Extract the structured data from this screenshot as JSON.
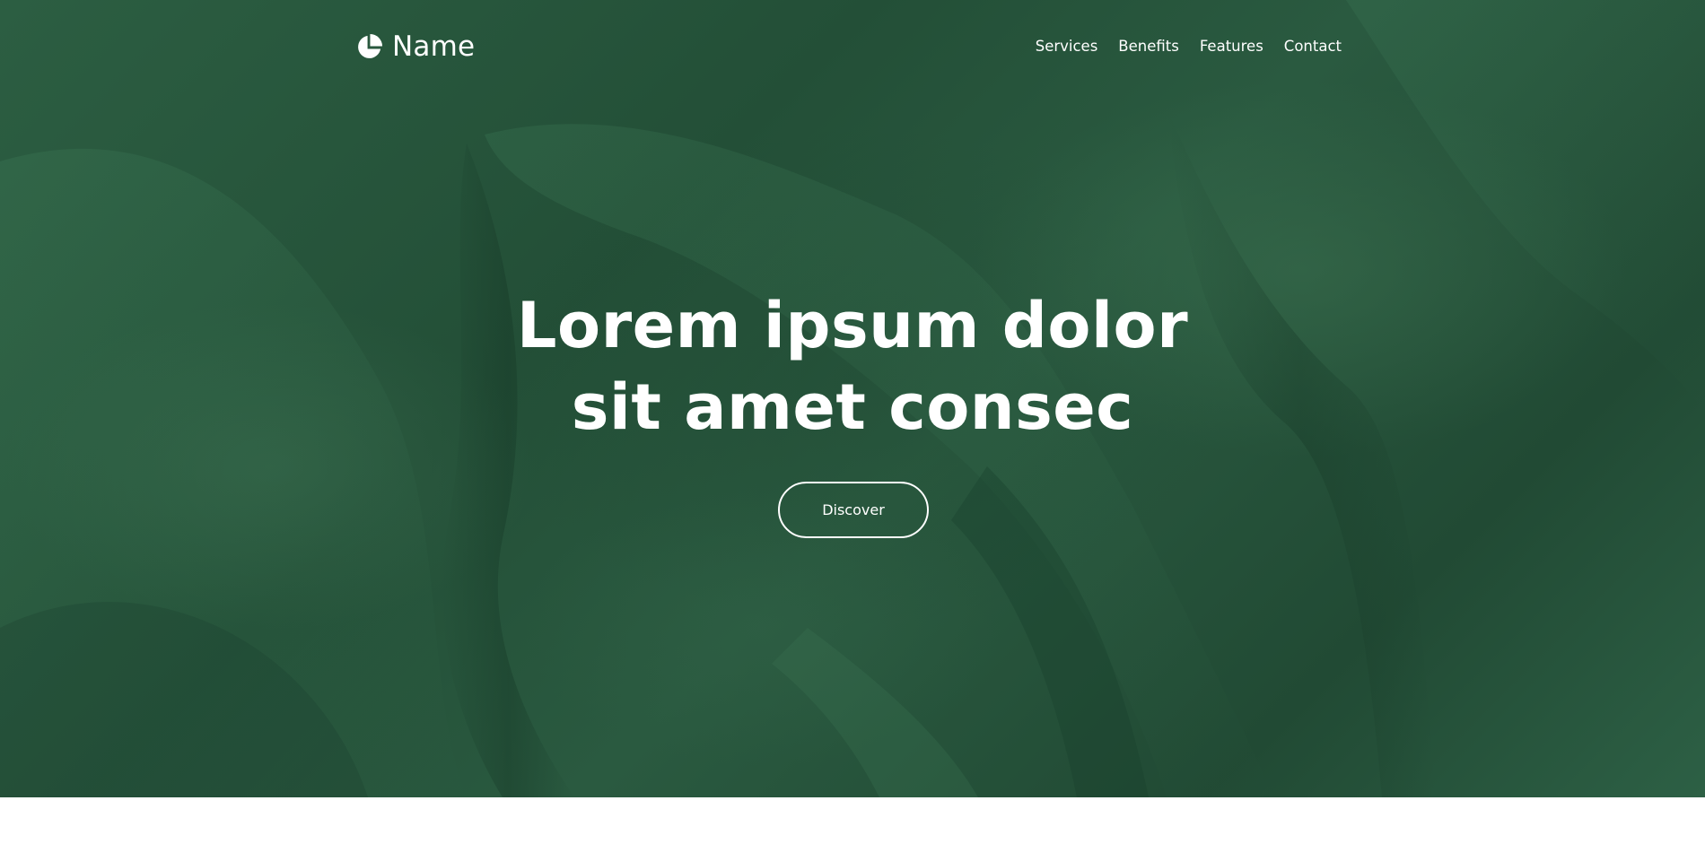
{
  "header": {
    "brand_name": "Name",
    "logo_icon": "pie-chart-icon",
    "nav": [
      {
        "label": "Services"
      },
      {
        "label": "Benefits"
      },
      {
        "label": "Features"
      },
      {
        "label": "Contact"
      }
    ]
  },
  "hero": {
    "headline_line1": "Lorem ipsum dolor",
    "headline_line2": "sit amet consec",
    "cta_label": "Discover",
    "background": "green-fabric-image"
  },
  "colors": {
    "hero_green": "#2a5a40",
    "text": "#ffffff",
    "page_background": "#ffffff"
  }
}
